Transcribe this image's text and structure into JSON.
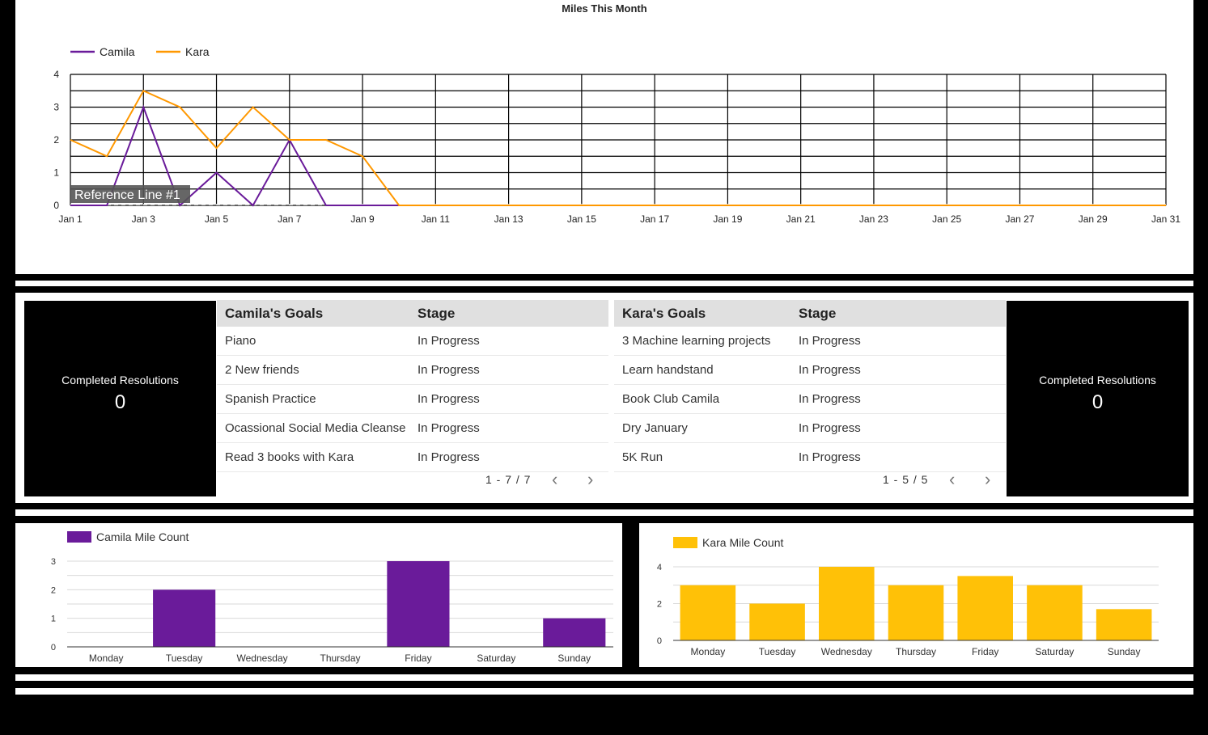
{
  "line_chart": {
    "title": "Miles This Month",
    "reference_line_label": "Reference Line #1"
  },
  "camila_table": {
    "headers": [
      "Camila's Goals",
      "Stage"
    ],
    "rows": [
      [
        "Piano",
        "In Progress"
      ],
      [
        "2 New friends",
        "In Progress"
      ],
      [
        "Spanish Practice",
        "In Progress"
      ],
      [
        "Ocassional Social Media Cleanse",
        "In Progress"
      ],
      [
        "Read 3 books with Kara",
        "In Progress"
      ]
    ],
    "pagination": "1 - 7 / 7"
  },
  "kara_table": {
    "headers": [
      "Kara's Goals",
      "Stage"
    ],
    "rows": [
      [
        "3 Machine learning projects",
        "In Progress"
      ],
      [
        "Learn handstand",
        "In Progress"
      ],
      [
        "Book Club Camila",
        "In Progress"
      ],
      [
        "Dry January",
        "In Progress"
      ],
      [
        "5K Run",
        "In Progress"
      ]
    ],
    "pagination": "1 - 5 / 5"
  },
  "camila_scorecard": {
    "label": "Completed Resolutions",
    "value": "0"
  },
  "kara_scorecard": {
    "label": "Completed Resolutions",
    "value": "0"
  },
  "pager_icons": {
    "prev": "‹",
    "next": "›"
  },
  "colors": {
    "camila": "#6a1b9a",
    "kara": "#ff9800",
    "kara_bar": "#ffc107"
  },
  "chart_data": [
    {
      "type": "line",
      "title": "Miles This Month",
      "x": [
        "Jan 1",
        "Jan 2",
        "Jan 3",
        "Jan 4",
        "Jan 5",
        "Jan 6",
        "Jan 7",
        "Jan 8",
        "Jan 9",
        "Jan 10",
        "Jan 11",
        "Jan 12",
        "Jan 13",
        "Jan 14",
        "Jan 15",
        "Jan 16",
        "Jan 17",
        "Jan 18",
        "Jan 19",
        "Jan 20",
        "Jan 21",
        "Jan 22",
        "Jan 23",
        "Jan 24",
        "Jan 25",
        "Jan 26",
        "Jan 27",
        "Jan 28",
        "Jan 29",
        "Jan 30",
        "Jan 31"
      ],
      "x_ticks": [
        "Jan 1",
        "Jan 3",
        "Jan 5",
        "Jan 7",
        "Jan 9",
        "Jan 11",
        "Jan 13",
        "Jan 15",
        "Jan 17",
        "Jan 19",
        "Jan 21",
        "Jan 23",
        "Jan 25",
        "Jan 27",
        "Jan 29",
        "Jan 31"
      ],
      "y_ticks": [
        0,
        1,
        2,
        3,
        4
      ],
      "ylim": [
        0,
        4
      ],
      "grid": true,
      "legend": "top-left",
      "series": [
        {
          "name": "Camila",
          "color": "#6a1b9a",
          "values": [
            0,
            0,
            3,
            0,
            1,
            0,
            2,
            0,
            0,
            0,
            0,
            0,
            0,
            0,
            0,
            0,
            0,
            0,
            0,
            0,
            0,
            0,
            0,
            0,
            0,
            0,
            0,
            0,
            0,
            0,
            0
          ]
        },
        {
          "name": "Kara",
          "color": "#ff9800",
          "values": [
            2,
            1.5,
            3.5,
            3,
            1.75,
            3,
            2,
            2,
            1.5,
            0,
            0,
            0,
            0,
            0,
            0,
            0,
            0,
            0,
            0,
            0,
            0,
            0,
            0,
            0,
            0,
            0,
            0,
            0,
            0,
            0,
            0
          ]
        }
      ],
      "reference_line": {
        "label": "Reference Line #1",
        "value": 0
      }
    },
    {
      "type": "bar",
      "categories": [
        "Monday",
        "Tuesday",
        "Wednesday",
        "Thursday",
        "Friday",
        "Saturday",
        "Sunday"
      ],
      "series": [
        {
          "name": "Camila Mile Count",
          "color": "#6a1b9a",
          "values": [
            0,
            2,
            0,
            0,
            3,
            0,
            1
          ]
        }
      ],
      "y_ticks": [
        0,
        1,
        2,
        3
      ],
      "ylim": [
        0,
        3
      ],
      "legend": "top-left"
    },
    {
      "type": "bar",
      "categories": [
        "Monday",
        "Tuesday",
        "Wednesday",
        "Thursday",
        "Friday",
        "Saturday",
        "Sunday"
      ],
      "series": [
        {
          "name": "Kara Mile Count",
          "color": "#ffc107",
          "values": [
            3,
            2,
            4,
            3,
            3.5,
            3,
            1.7
          ]
        }
      ],
      "y_ticks": [
        0,
        2,
        4
      ],
      "ylim": [
        0,
        4
      ],
      "legend": "top-left"
    }
  ]
}
